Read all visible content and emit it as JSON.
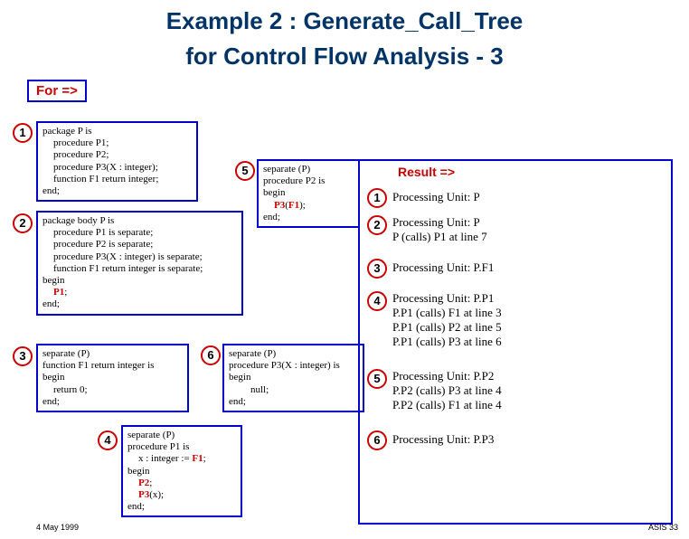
{
  "title_line1": "Example 2 : Generate_Call_Tree",
  "title_line2": "for Control Flow Analysis - 3",
  "for_label": "For =>",
  "box1": {
    "l1": "package P is",
    "l2": "procedure P1;",
    "l3": "procedure P2;",
    "l4": "procedure P3(X : integer);",
    "l5": "function F1 return integer;",
    "l6": "end;"
  },
  "box2": {
    "l1": "package body P is",
    "l2": "procedure P1 is separate;",
    "l3": "procedure P2 is separate;",
    "l4": "procedure P3(X : integer) is separate;",
    "l5": "function F1 return integer is separate;",
    "l6": "begin",
    "l7a": "P1",
    "l7b": ";",
    "l8": "end;"
  },
  "box3": {
    "l1": "separate (P)",
    "l2": "function F1 return integer is",
    "l3": "begin",
    "l4": "return 0;",
    "l5": "end;"
  },
  "box4": {
    "l1": "separate (P)",
    "l2": "procedure P1 is",
    "l3a": "x : integer := ",
    "l3b": "F1",
    "l3c": ";",
    "l4": "begin",
    "l5a": "P2",
    "l5b": ";",
    "l6a": "P3",
    "l6b": "(x);",
    "l7": "end;"
  },
  "box5": {
    "l1": "separate (P)",
    "l2": "procedure P2 is",
    "l3": "begin",
    "l4a": "P3",
    "l4b": "(",
    "l4c": "F1",
    "l4d": ");",
    "l5": "end;"
  },
  "box6": {
    "l1": "separate (P)",
    "l2": "procedure P3(X : integer) is",
    "l3": "begin",
    "l4": "null;",
    "l5": "end;"
  },
  "result_label": "Result =>",
  "r1": "Processing Unit: P",
  "r2a": "Processing Unit: P",
  "r2b": "P (calls) P1 at line  7",
  "r3": "Processing Unit: P.F1",
  "r4a": "Processing Unit: P.P1",
  "r4b": "P.P1 (calls) F1 at line  3",
  "r4c": "P.P1 (calls) P2 at line  5",
  "r4d": "P.P1 (calls) P3 at line  6",
  "r5a": "Processing Unit: P.P2",
  "r5b": "P.P2 (calls) P3 at line  4",
  "r5c": "P.P2 (calls) F1 at line  4",
  "r6": "Processing Unit: P.P3",
  "footer_date": "4 May 1999",
  "footer_right": "ASIS 33",
  "n1": "1",
  "n2": "2",
  "n3": "3",
  "n4": "4",
  "n5": "5",
  "n6": "6"
}
